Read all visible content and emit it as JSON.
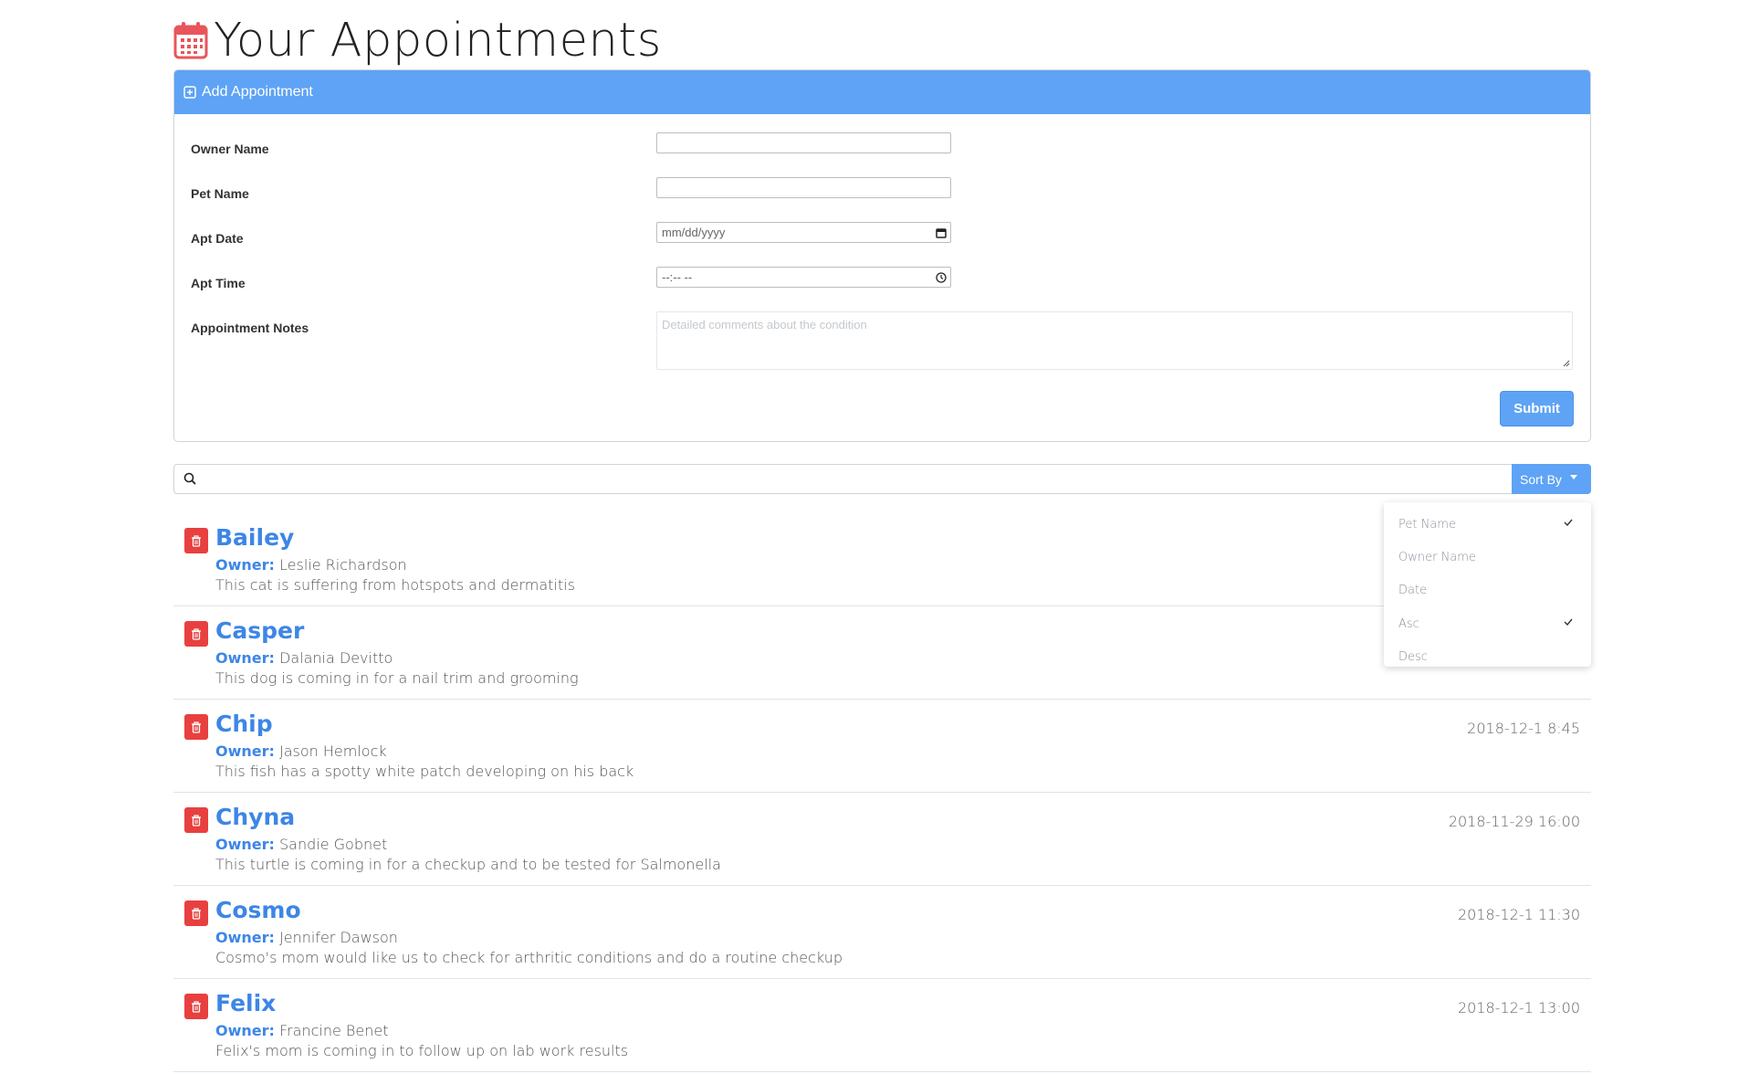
{
  "page": {
    "title": "Your Appointments"
  },
  "add_card": {
    "header": "Add Appointment",
    "fields": [
      {
        "label": "Owner Name",
        "value": "",
        "placeholder": ""
      },
      {
        "label": "Pet Name",
        "value": "",
        "placeholder": ""
      },
      {
        "label": "Apt Date",
        "value": "mm/dd/yyyy",
        "placeholder": ""
      },
      {
        "label": "Apt Time",
        "value": "--:-- --",
        "placeholder": ""
      },
      {
        "label": "Appointment Notes",
        "placeholder": "Detailed comments about the condition"
      }
    ],
    "submit_label": "Submit"
  },
  "search": {
    "value": "",
    "sort_label": "Sort By"
  },
  "sort_menu": {
    "items": [
      {
        "label": "Pet Name",
        "checked": true
      },
      {
        "label": "Owner Name",
        "checked": false
      },
      {
        "label": "Date",
        "checked": false
      },
      {
        "label": "Asc",
        "checked": true
      },
      {
        "label": "Desc",
        "checked": false
      }
    ]
  },
  "appointments": [
    {
      "pet": "Bailey",
      "owner_label": "Owner:",
      "owner": "Leslie Richardson",
      "notes": "This cat is suffering from hotspots and dermatitis",
      "date": ""
    },
    {
      "pet": "Casper",
      "owner_label": "Owner:",
      "owner": "Dalania Devitto",
      "notes": "This dog is coming in for a nail trim and grooming",
      "date": ""
    },
    {
      "pet": "Chip",
      "owner_label": "Owner:",
      "owner": "Jason Hemlock",
      "notes": "This fish has a spotty white patch developing on his back",
      "date": "2018-12-1 8:45"
    },
    {
      "pet": "Chyna",
      "owner_label": "Owner:",
      "owner": "Sandie Gobnet",
      "notes": "This turtle is coming in for a checkup and to be tested for Salmonella",
      "date": "2018-11-29 16:00"
    },
    {
      "pet": "Cosmo",
      "owner_label": "Owner:",
      "owner": "Jennifer Dawson",
      "notes": "Cosmo's mom would like us to check for arthritic conditions and do a routine checkup",
      "date": "2018-12-1 11:30"
    },
    {
      "pet": "Felix",
      "owner_label": "Owner:",
      "owner": "Francine Benet",
      "notes": "Felix's mom is coming in to follow up on lab work results",
      "date": "2018-12-1 13:00"
    }
  ],
  "colors": {
    "accent": "#5ea3f5",
    "link": "#3d86e6",
    "danger": "#e8403f",
    "calendar_icon": "#e8555a"
  },
  "icons": {
    "title": "calendar-icon",
    "card_header": "plus-square-icon",
    "search": "search-icon",
    "delete": "trash-icon",
    "check": "check-icon"
  }
}
